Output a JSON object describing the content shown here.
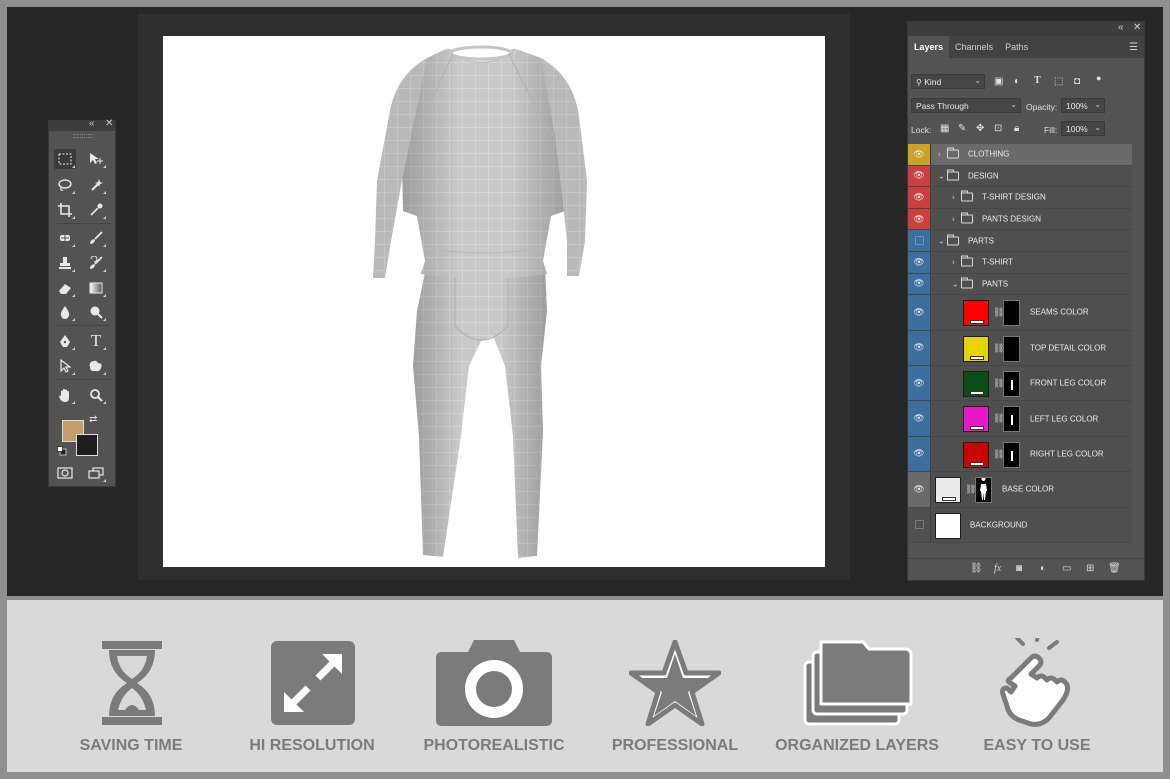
{
  "tools_panel": {
    "collapse_glyph": "«",
    "close_glyph": "✕",
    "icons": [
      "rectangular-marquee-icon",
      "move-icon",
      "lasso-icon",
      "magic-wand-icon",
      "crop-icon",
      "eyedropper-icon",
      "healing-brush-icon",
      "brush-icon",
      "clone-stamp-icon",
      "history-brush-icon",
      "eraser-icon",
      "gradient-icon",
      "blur-icon",
      "dodge-icon",
      "pen-icon",
      "type-icon",
      "path-selection-icon",
      "custom-shape-icon",
      "hand-icon",
      "zoom-icon"
    ],
    "foreground_color": "#c39d6b",
    "background_color": "#1e1e1e"
  },
  "layers_panel": {
    "collapse_glyph": "«",
    "close_glyph": "✕",
    "tabs": [
      {
        "label": "Layers",
        "active": true
      },
      {
        "label": "Channels",
        "active": false
      },
      {
        "label": "Paths",
        "active": false
      }
    ],
    "filter": {
      "label": "Kind"
    },
    "blend_mode": "Pass Through",
    "opacity_label": "Opacity:",
    "opacity_value": "100%",
    "lock_label": "Lock:",
    "fill_label": "Fill:",
    "fill_value": "100%",
    "layers": [
      {
        "name": "CLOTHING",
        "kind": "group",
        "indent": 0,
        "expanded": false,
        "visible": true,
        "color": "#c9a227",
        "selected": true
      },
      {
        "name": "DESIGN",
        "kind": "group",
        "indent": 0,
        "expanded": true,
        "visible": true,
        "color": "#c94040"
      },
      {
        "name": "T-SHIRT DESIGN",
        "kind": "group",
        "indent": 1,
        "expanded": false,
        "visible": true,
        "color": "#c94040"
      },
      {
        "name": "PANTS DESIGN",
        "kind": "group",
        "indent": 1,
        "expanded": false,
        "visible": true,
        "color": "#c94040"
      },
      {
        "name": "PARTS",
        "kind": "group",
        "indent": 0,
        "expanded": true,
        "visible": false,
        "color": "#3d6e9e"
      },
      {
        "name": "T-SHIRT",
        "kind": "group",
        "indent": 1,
        "expanded": false,
        "visible": true,
        "color": "#3d6e9e"
      },
      {
        "name": "PANTS",
        "kind": "group",
        "indent": 1,
        "expanded": true,
        "visible": true,
        "color": "#3d6e9e"
      },
      {
        "name": "SEAMS COLOR",
        "kind": "fill",
        "indent": 2,
        "visible": true,
        "color": "#3d6e9e",
        "swatch": "#ff0000"
      },
      {
        "name": "TOP DETAIL COLOR",
        "kind": "fill",
        "indent": 2,
        "visible": true,
        "color": "#3d6e9e",
        "swatch": "#e5d400"
      },
      {
        "name": "FRONT LEG COLOR",
        "kind": "fill",
        "indent": 2,
        "visible": true,
        "color": "#3d6e9e",
        "swatch": "#0b4d14"
      },
      {
        "name": "LEFT LEG COLOR",
        "kind": "fill",
        "indent": 2,
        "visible": true,
        "color": "#3d6e9e",
        "swatch": "#e619c8"
      },
      {
        "name": "RIGHT LEG COLOR",
        "kind": "fill",
        "indent": 2,
        "visible": true,
        "color": "#3d6e9e",
        "swatch": "#cc0000"
      },
      {
        "name": "BASE COLOR",
        "kind": "fill",
        "indent": 0,
        "visible": true,
        "color": "#6a6a6a",
        "swatch": "#ececec"
      },
      {
        "name": "BACKGROUND",
        "kind": "pixel",
        "indent": 0,
        "visible": false,
        "color": "#4f4f4f",
        "swatch": "#ffffff"
      }
    ]
  },
  "features": [
    {
      "label": "SAVING TIME",
      "icon": "hourglass-icon"
    },
    {
      "label": "HI RESOLUTION",
      "icon": "expand-arrows-icon"
    },
    {
      "label": "PHOTOREALISTIC",
      "icon": "camera-icon"
    },
    {
      "label": "PROFESSIONAL",
      "icon": "star-icon"
    },
    {
      "label": "ORGANIZED LAYERS",
      "icon": "stacked-folders-icon"
    },
    {
      "label": "EASY TO USE",
      "icon": "pointing-hand-icon"
    }
  ]
}
